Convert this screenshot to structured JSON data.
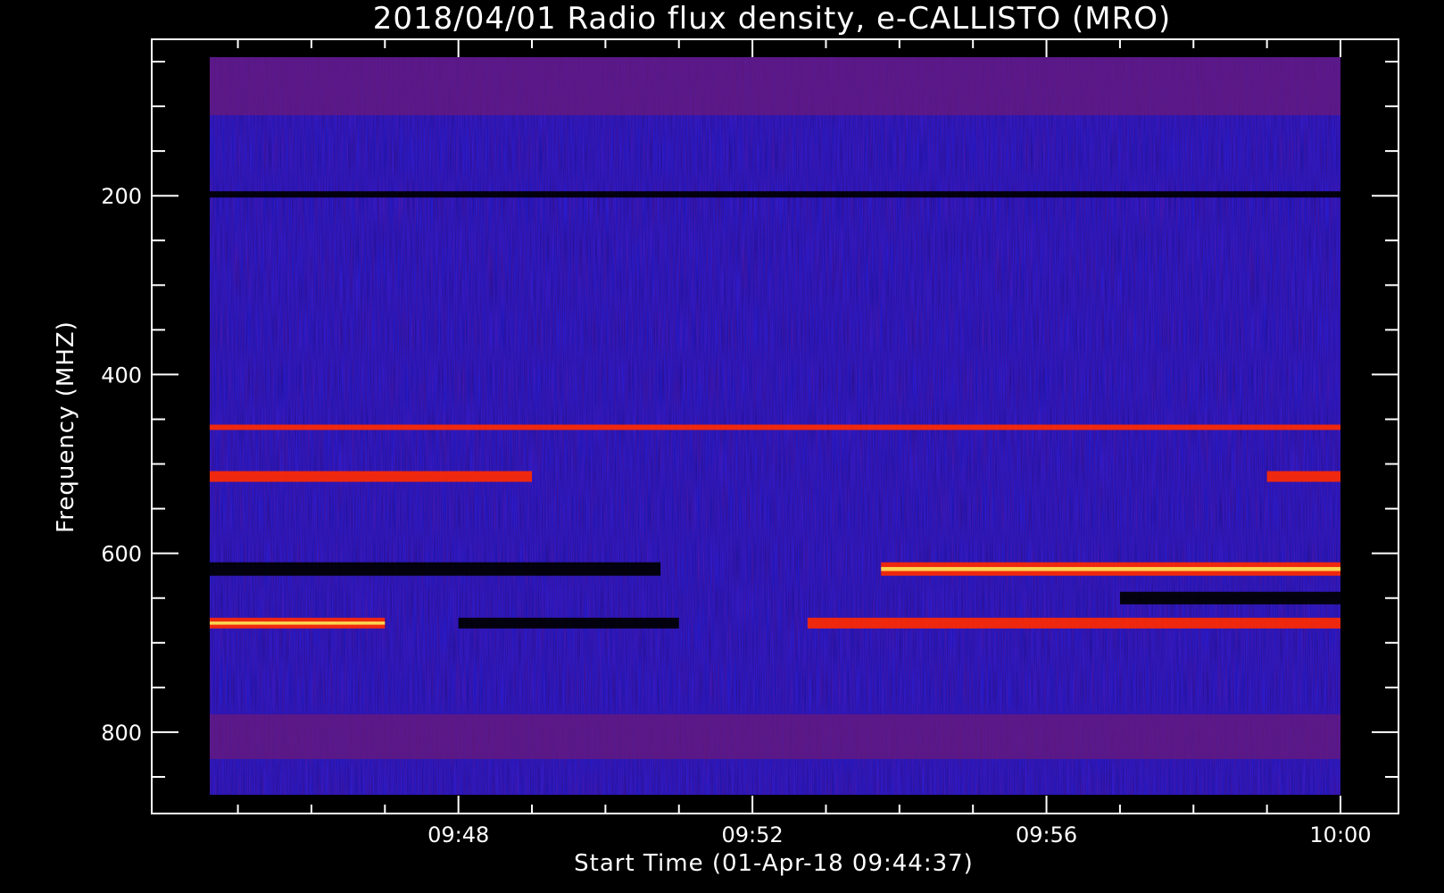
{
  "chart_data": {
    "type": "heatmap",
    "title": "2018/04/01  Radio flux density, e-CALLISTO (MRO)",
    "xlabel": "Start Time (01-Apr-18 09:44:37)",
    "ylabel": "Frequency (MHZ)",
    "x_ticks": [
      "09:48",
      "09:52",
      "09:56",
      "10:00"
    ],
    "y_ticks": [
      "200",
      "400",
      "600",
      "800"
    ],
    "x_range": [
      "09:44:37",
      "10:00:00"
    ],
    "y_range_mhz": [
      45,
      870
    ],
    "y_direction": "frequency increases downward",
    "grid": false,
    "colormap": {
      "low": "#000000",
      "mid": "#1a1adf",
      "high": "#ff2a00",
      "peak": "#ffff60"
    },
    "bands": [
      {
        "start": "09:44:37",
        "end": "10:00:00",
        "f_low_mhz": 45,
        "f_high_mhz": 110,
        "level": "mixed red/blue, bursty"
      },
      {
        "start": "09:44:37",
        "end": "10:00:00",
        "f_low_mhz": 195,
        "f_high_mhz": 202,
        "level": "dark line"
      },
      {
        "start": "09:44:37",
        "end": "10:00:00",
        "f_low_mhz": 456,
        "f_high_mhz": 462,
        "level": "red line"
      },
      {
        "start": "09:44:37",
        "end": "09:49:00",
        "f_low_mhz": 508,
        "f_high_mhz": 520,
        "level": "bright red"
      },
      {
        "start": "09:59:00",
        "end": "10:00:00",
        "f_low_mhz": 508,
        "f_high_mhz": 520,
        "level": "bright red"
      },
      {
        "start": "09:44:37",
        "end": "09:50:45",
        "f_low_mhz": 610,
        "f_high_mhz": 625,
        "level": "dark"
      },
      {
        "start": "09:53:45",
        "end": "10:00:00",
        "f_low_mhz": 610,
        "f_high_mhz": 625,
        "level": "bright red/yellow"
      },
      {
        "start": "09:57:00",
        "end": "10:00:00",
        "f_low_mhz": 643,
        "f_high_mhz": 657,
        "level": "dark"
      },
      {
        "start": "09:44:37",
        "end": "09:47:00",
        "f_low_mhz": 672,
        "f_high_mhz": 684,
        "level": "bright red/yellow"
      },
      {
        "start": "09:48:00",
        "end": "09:51:00",
        "f_low_mhz": 672,
        "f_high_mhz": 684,
        "level": "dark"
      },
      {
        "start": "09:52:45",
        "end": "10:00:00",
        "f_low_mhz": 672,
        "f_high_mhz": 684,
        "level": "red"
      },
      {
        "start": "09:44:37",
        "end": "10:00:00",
        "f_low_mhz": 780,
        "f_high_mhz": 830,
        "level": "mixed red/dark, bursty"
      }
    ]
  }
}
